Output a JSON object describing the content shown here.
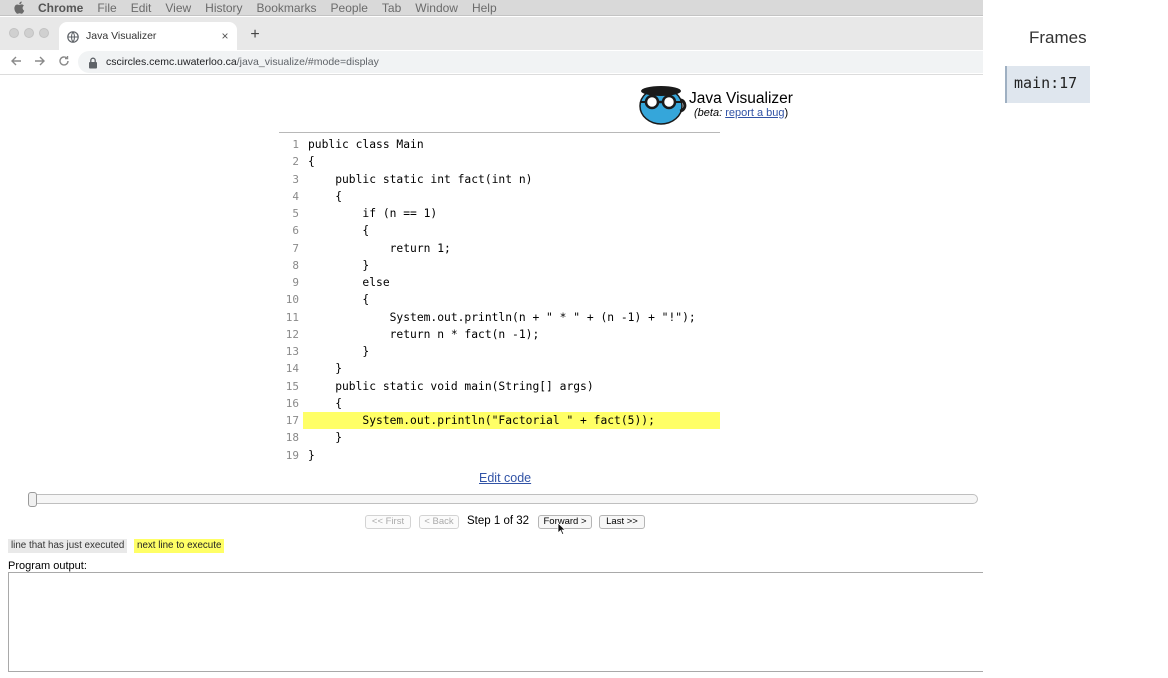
{
  "menubar": {
    "app": "Chrome",
    "items": [
      "File",
      "Edit",
      "View",
      "History",
      "Bookmarks",
      "People",
      "Tab",
      "Window",
      "Help"
    ]
  },
  "browser": {
    "tab_title": "Java Visualizer",
    "tab_close": "×",
    "new_tab": "+",
    "url_host": "cscircles.cemc.uwaterloo.ca",
    "url_path": "/java_visualize/#mode=display"
  },
  "header": {
    "title": "Java Visualizer",
    "beta_prefix": "(beta: ",
    "report_link": "report a bug",
    "beta_suffix": ")"
  },
  "code": {
    "current_line": 17,
    "lines": [
      "public class Main",
      "{",
      "    public static int fact(int n)",
      "    {",
      "        if (n == 1)",
      "        {",
      "            return 1;",
      "        }",
      "        else",
      "        {",
      "            System.out.println(n + \" * \" + (n -1) + \"!\");",
      "            return n * fact(n -1);",
      "        }",
      "    }",
      "    public static void main(String[] args)",
      "    {",
      "        System.out.println(\"Factorial \" + fact(5));",
      "    }",
      "}"
    ]
  },
  "edit_code": "Edit code",
  "controls": {
    "first": "<< First",
    "back": "< Back",
    "step_text": "Step 1 of 32",
    "forward": "Forward >",
    "last": "Last >>",
    "step_current": 1,
    "step_total": 32
  },
  "legend": {
    "executed": "line that has just executed",
    "next": "next line to execute"
  },
  "output": {
    "label": "Program output:",
    "text": ""
  },
  "frames": {
    "title": "Frames",
    "items": [
      "main:17"
    ]
  },
  "colors": {
    "highlight": "#ffff66",
    "link": "#3153a6",
    "frame_bg": "#dfe6ee"
  }
}
